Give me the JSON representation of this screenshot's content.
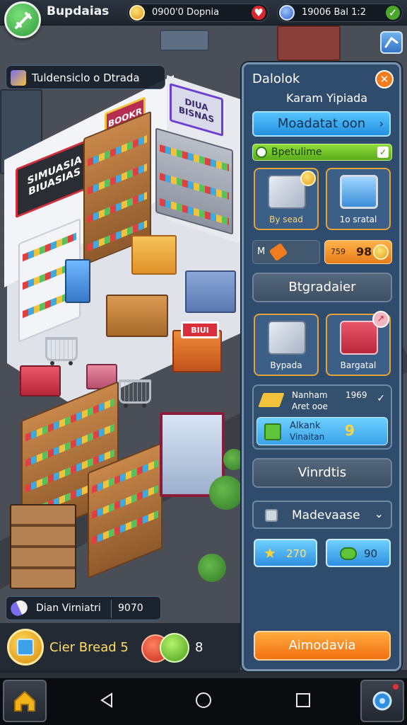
{
  "topbar": {
    "title": "Bupdaias",
    "coins": "0900'0 Dopnia",
    "gems": "19006 Bal 1:2"
  },
  "world": {
    "store_label": "Tuldensiclo o Dtrada",
    "sign_main": "SIMUASIA BIUASIAS",
    "sign_small": "BOOKR",
    "sign_top": "DIUA BISNAS",
    "sign_stall": "BIUI",
    "bottom_info_label": "Dian Virniatri",
    "bottom_info_value": "9070"
  },
  "panel": {
    "title": "Dalolok",
    "subtitle": "Karam Yipiada",
    "primary_button": "Moadatat oon",
    "status_label": "Bpetulime",
    "card1_label": "By sead",
    "card2_label": "1o sratal",
    "stat_left": "M",
    "stat_right_prefix": "759",
    "stat_right_value": "98",
    "upgrade_button": "Btgradaier",
    "card3_label": "Bypada",
    "card4_label": "Bargatal",
    "info_name": "Nanham",
    "info_num": "1969",
    "info_sub": "Aret ooe",
    "offer_title": "Alkank",
    "offer_sub": "Vinaitan",
    "offer_value": "9",
    "vinrdtis_button": "Vinrdtis",
    "dropdown_label": "Madevaase",
    "price1": "270",
    "price2": "90",
    "action_button": "Aimodavia"
  },
  "hud": {
    "label": "Cier Bread 5",
    "count": "8"
  },
  "colors": {
    "accent_orange": "#f27012",
    "accent_blue": "#2290e0",
    "accent_green": "#5aab1c",
    "panel_bg": "#2f4c6c"
  }
}
